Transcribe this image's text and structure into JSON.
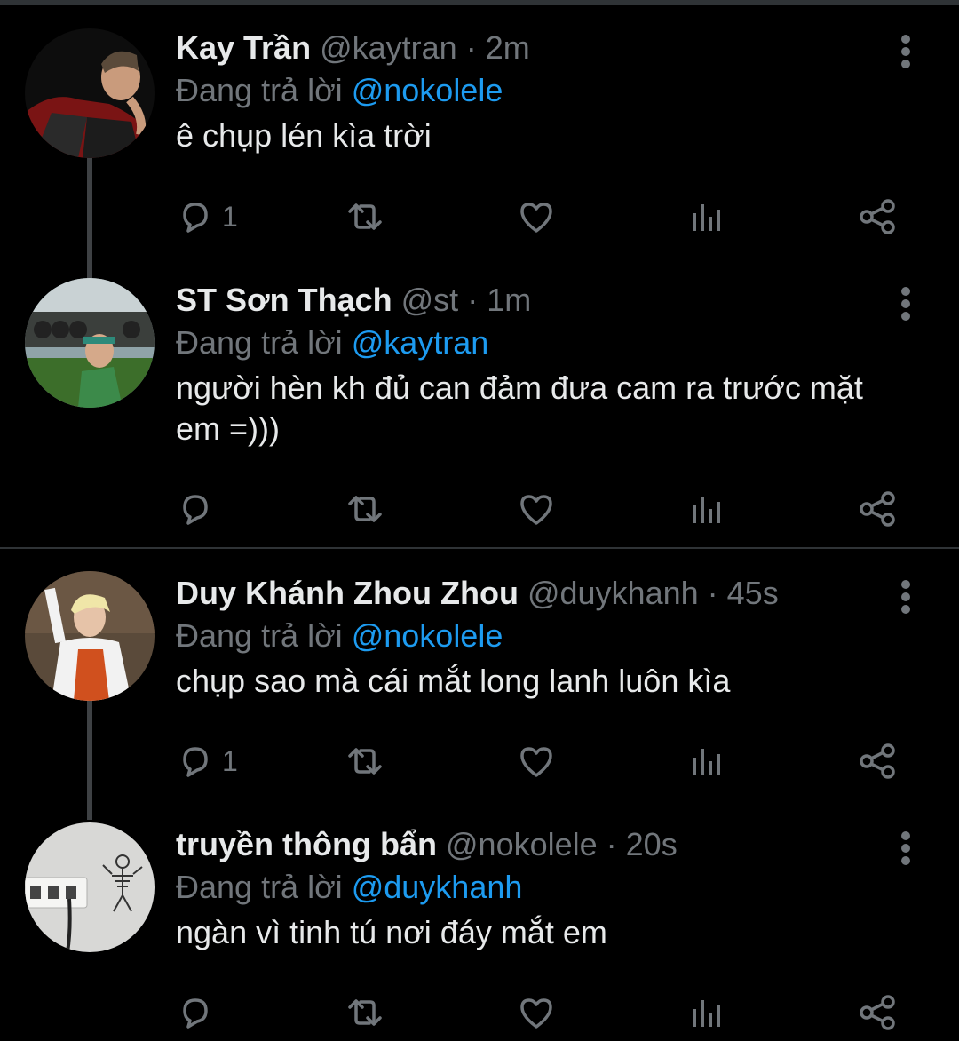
{
  "reply_prefix": "Đang trả lời",
  "colors": {
    "background": "#000000",
    "text": "#e7e9ea",
    "muted": "#71767b",
    "mention": "#1d9bf0"
  },
  "tweets": [
    {
      "name": "Kay Trần",
      "handle": "@kaytran",
      "time": "· 2m",
      "reply_to": "@nokolele",
      "text": "ê chụp lén kìa trời",
      "reply_count": "1"
    },
    {
      "name": "ST Sơn Thạch",
      "handle": "@st",
      "time": "· 1m",
      "reply_to": "@kaytran",
      "text": "người hèn kh đủ can đảm đưa cam ra trước mặt em =)))",
      "reply_count": ""
    },
    {
      "name": "Duy Khánh Zhou Zhou",
      "handle": "@duykhanh",
      "time": "· 45s",
      "reply_to": "@nokolele",
      "text": "chụp sao mà cái mắt long lanh luôn kìa",
      "reply_count": "1"
    },
    {
      "name": "truyền thông bẩn",
      "handle": "@nokolele",
      "time": "· 20s",
      "reply_to": "@duykhanh",
      "text": "ngàn vì tinh tú nơi đáy mắt em",
      "reply_count": ""
    }
  ],
  "icons": [
    "reply-icon",
    "retweet-icon",
    "like-icon",
    "analytics-icon",
    "share-icon",
    "more-icon"
  ]
}
